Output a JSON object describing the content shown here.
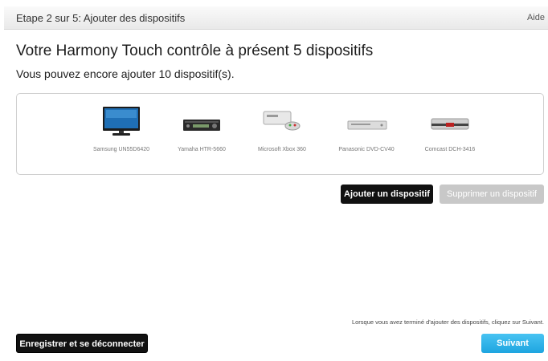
{
  "header": {
    "step_title": "Etape 2 sur 5: Ajouter des dispositifs",
    "help_label": "Aide"
  },
  "main": {
    "title": "Votre Harmony Touch contrôle à présent 5 dispositifs",
    "subtitle": "Vous pouvez encore ajouter 10 dispositif(s)."
  },
  "devices": [
    {
      "label": "Samsung UN55D6420",
      "icon": "television-icon"
    },
    {
      "label": "Yamaha HTR-5660",
      "icon": "av-receiver-icon"
    },
    {
      "label": "Microsoft Xbox 360",
      "icon": "game-console-icon"
    },
    {
      "label": "Panasonic DVD-CV40",
      "icon": "dvd-player-icon"
    },
    {
      "label": "Comcast DCH-3416",
      "icon": "cable-box-icon"
    }
  ],
  "actions": {
    "add_label": "Ajouter un dispositif",
    "remove_label": "Supprimer un dispositif"
  },
  "footer": {
    "hint": "Lorsque vous avez terminé d'ajouter des dispositifs, cliquez sur Suivant.",
    "save_label": "Enregistrer et se déconnecter",
    "next_label": "Suivant"
  },
  "colors": {
    "accent": "#1ea5e0",
    "dark_button": "#111111",
    "disabled_button": "#c8c8c8"
  }
}
